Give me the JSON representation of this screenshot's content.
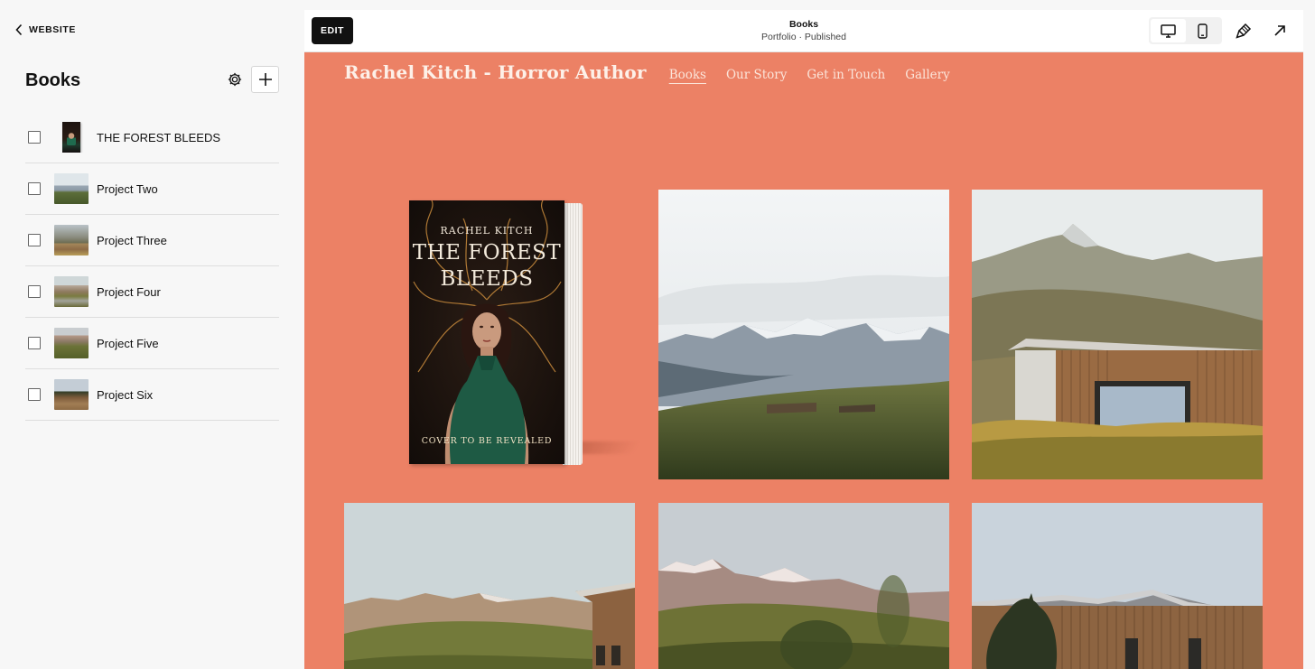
{
  "sidebar": {
    "back_label": "WEBSITE",
    "title": "Books",
    "items": [
      {
        "label": "THE FOREST BLEEDS",
        "thumb": "book-cover-thumbnail"
      },
      {
        "label": "Project Two",
        "thumb": "mountain-landscape-thumbnail"
      },
      {
        "label": "Project Three",
        "thumb": "cabin-thumbnail"
      },
      {
        "label": "Project Four",
        "thumb": "landscape-thumbnail"
      },
      {
        "label": "Project Five",
        "thumb": "hills-thumbnail"
      },
      {
        "label": "Project Six",
        "thumb": "cabin-trees-thumbnail"
      }
    ]
  },
  "topbar": {
    "edit_label": "EDIT",
    "page_title": "Books",
    "page_status": "Portfolio · Published",
    "icons": [
      "desktop-icon",
      "mobile-icon",
      "paintbrush-icon",
      "external-arrow-icon"
    ]
  },
  "site": {
    "title": "Rachel Kitch - Horror Author",
    "nav": [
      "Books",
      "Our Story",
      "Get in Touch",
      "Gallery"
    ],
    "current_nav": "Books"
  },
  "book": {
    "author": "RACHEL KITCH",
    "title_line1": "THE FOREST",
    "title_line2": "BLEEDS",
    "tagline": "COVER TO BE REVEALED"
  },
  "colors": {
    "site_background": "#ec8165",
    "edit_button": "#111111",
    "panel_background": "#f7f7f7"
  }
}
